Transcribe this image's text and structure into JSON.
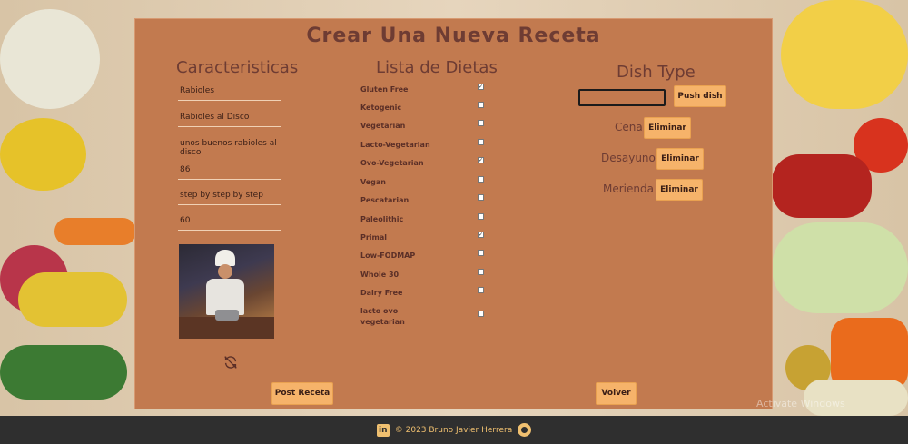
{
  "page": {
    "title": "Crear Una Nueva Receta"
  },
  "characteristics": {
    "heading": "Caracteristicas",
    "fields": [
      {
        "value": "Rabioles"
      },
      {
        "value": "Rabioles al Disco"
      },
      {
        "value": "unos buenos rabioles al disco"
      },
      {
        "value": "86"
      },
      {
        "value": "step by step by step"
      },
      {
        "value": "60"
      }
    ],
    "image_alt": "chef-image",
    "refresh_icon": "refresh-icon"
  },
  "diets": {
    "heading": "Lista de Dietas",
    "items": [
      {
        "label": "Gluten Free",
        "checked": true
      },
      {
        "label": "Ketogenic",
        "checked": false
      },
      {
        "label": "Vegetarian",
        "checked": false
      },
      {
        "label": "Lacto-Vegetarian",
        "checked": false
      },
      {
        "label": "Ovo-Vegetarian",
        "checked": true
      },
      {
        "label": "Vegan",
        "checked": false
      },
      {
        "label": "Pescatarian",
        "checked": false
      },
      {
        "label": "Paleolithic",
        "checked": false
      },
      {
        "label": "Primal",
        "checked": true
      },
      {
        "label": "Low-FODMAP",
        "checked": false
      },
      {
        "label": "Whole 30",
        "checked": false
      },
      {
        "label": "Dairy Free",
        "checked": false
      },
      {
        "label": "lacto ovo vegetarian",
        "checked": false
      }
    ]
  },
  "dish_types": {
    "heading": "Dish Type",
    "input_value": "",
    "push_label": "Push dish",
    "remove_label": "Eliminar",
    "items": [
      {
        "name": "Cena"
      },
      {
        "name": "Desayuno"
      },
      {
        "name": "Merienda"
      }
    ]
  },
  "actions": {
    "post_label": "Post Receta",
    "back_label": "Volver"
  },
  "footer": {
    "text": "© 2023 Bruno Javier Herrera",
    "linkedin_icon": "linkedin-icon",
    "github_icon": "github-icon"
  },
  "watermark": {
    "text": "Activate Windows"
  },
  "colors": {
    "card": "#c27a4f",
    "accent": "#f6b36a",
    "heading": "#6e3c33",
    "footer": "#2f2f2f"
  }
}
